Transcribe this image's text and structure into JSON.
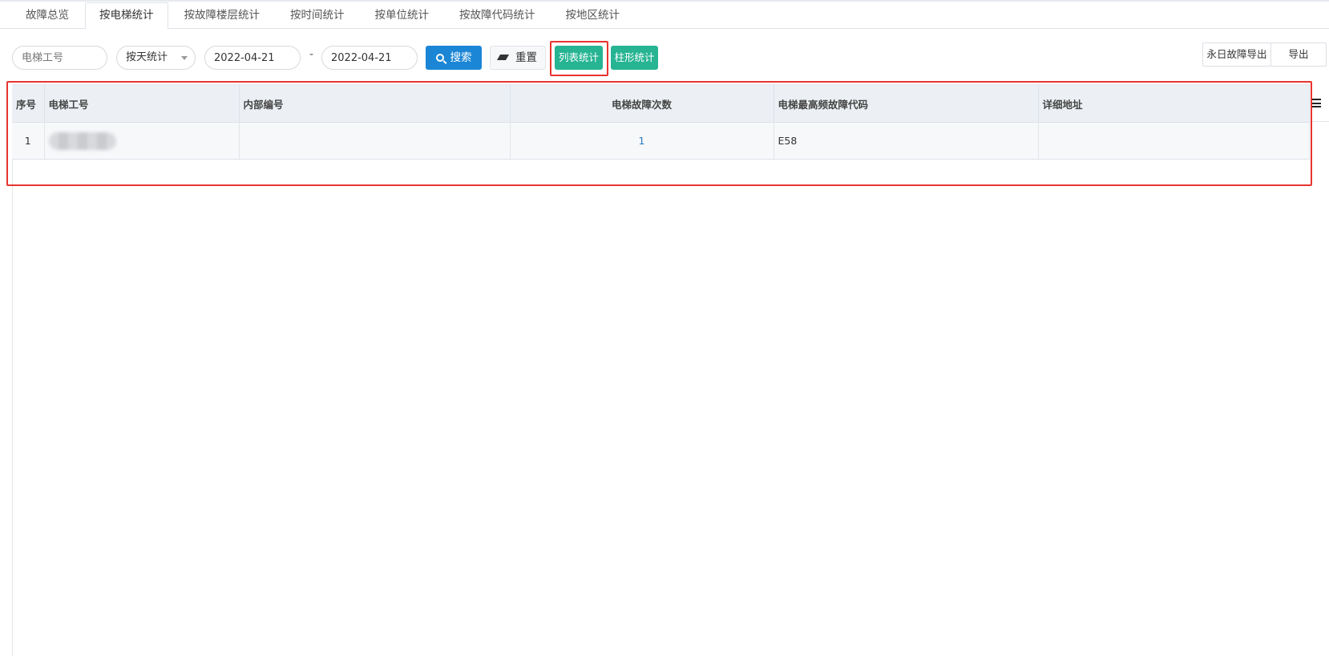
{
  "tabs": [
    {
      "label": "故障总览",
      "active": false
    },
    {
      "label": "按电梯统计",
      "active": true
    },
    {
      "label": "按故障楼层统计",
      "active": false
    },
    {
      "label": "按时间统计",
      "active": false
    },
    {
      "label": "按单位统计",
      "active": false
    },
    {
      "label": "按故障代码统计",
      "active": false
    },
    {
      "label": "按地区统计",
      "active": false
    }
  ],
  "toolbar": {
    "elevator_no_placeholder": "电梯工号",
    "period_select": "按天统计",
    "start_date": "2022-04-21",
    "date_separator": "-",
    "end_date": "2022-04-21",
    "search_label": "搜索",
    "reset_label": "重置",
    "list_stats_label": "列表统计",
    "bar_stats_label": "柱形统计",
    "daily_export_label": "永日故障导出",
    "export_label": "导出"
  },
  "table": {
    "columns": [
      "序号",
      "电梯工号",
      "内部编号",
      "电梯故障次数",
      "电梯最高频故障代码",
      "详细地址"
    ],
    "rows": [
      {
        "index": "1",
        "elevator_no": "",
        "internal_no": "",
        "fault_count": "1",
        "top_fault_code": "E58",
        "address": ""
      }
    ]
  },
  "colors": {
    "primary_blue": "#1c86d6",
    "green": "#26b493",
    "highlight_red": "#e8342f",
    "header_bg": "#ecf0f5"
  }
}
